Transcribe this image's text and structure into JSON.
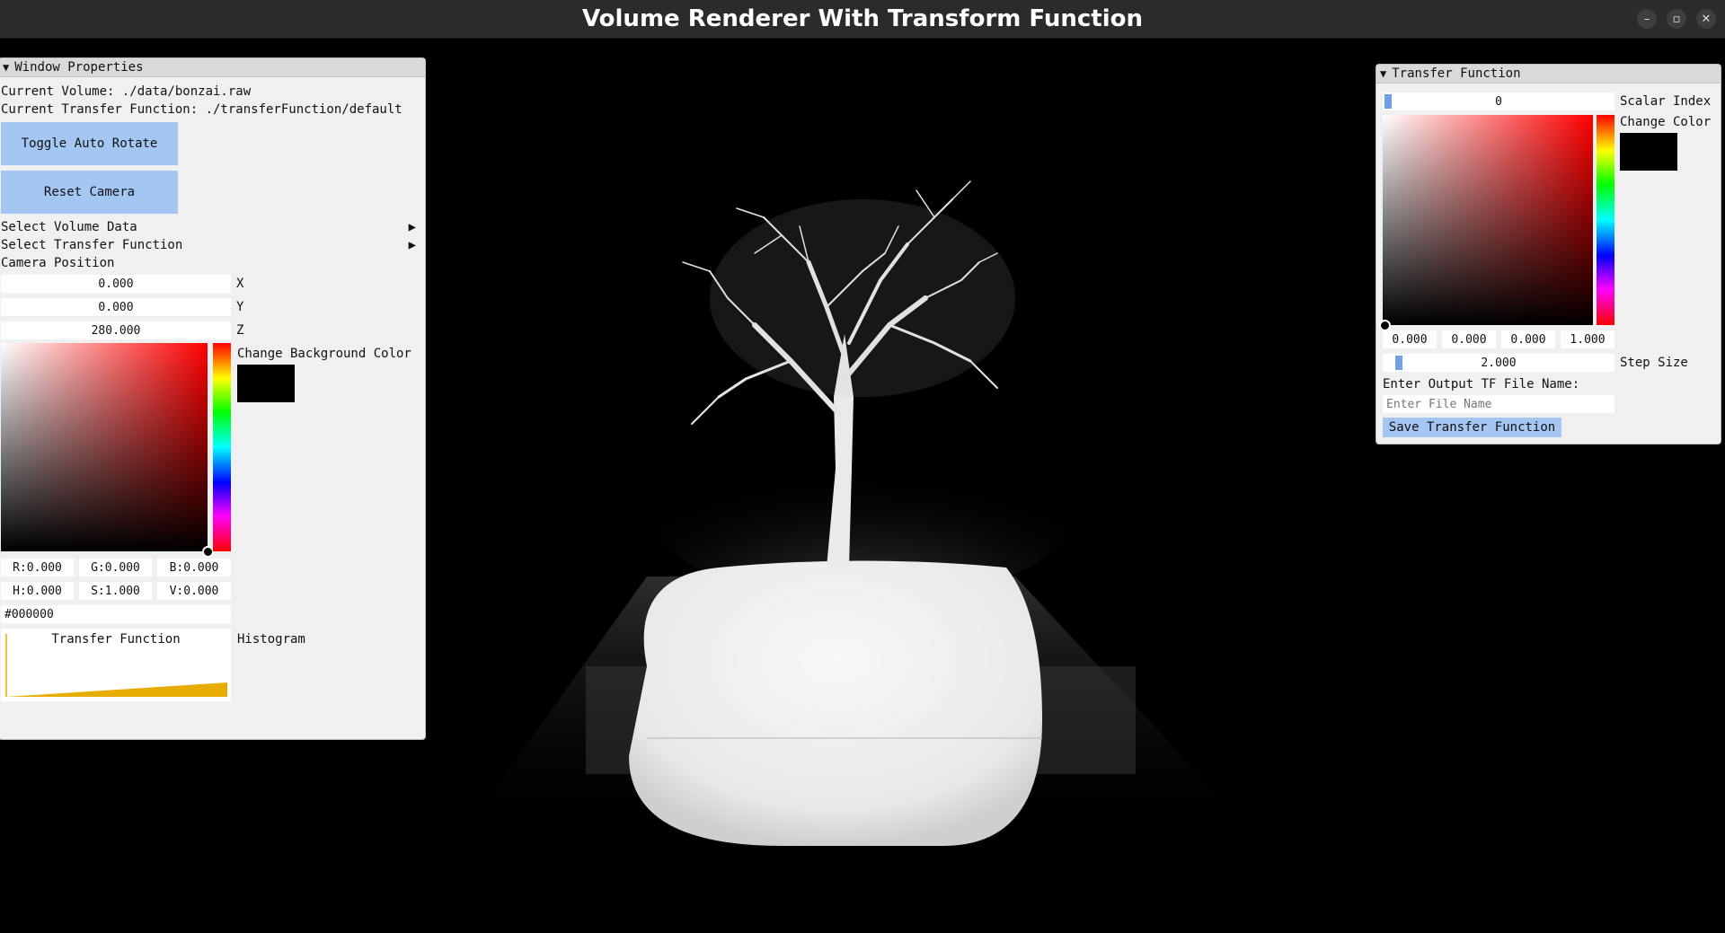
{
  "window": {
    "title": "Volume Renderer With Transform Function"
  },
  "window_controls": {
    "minimize": "–",
    "restore": "▫",
    "close": "✕"
  },
  "window_properties": {
    "header": "Window Properties",
    "current_volume": "Current Volume: ./data/bonzai.raw",
    "current_tf": "Current Transfer Function: ./transferFunction/default",
    "toggle_auto_rotate": "Toggle Auto Rotate",
    "reset_camera": "Reset Camera",
    "select_volume": "Select Volume Data",
    "select_tf": "Select Transfer Function",
    "camera_position_label": "Camera Position",
    "camera": {
      "x": "0.000",
      "y": "0.000",
      "z": "280.000",
      "x_label": "X",
      "y_label": "Y",
      "z_label": "Z"
    },
    "bg_color_label": "Change Background Color",
    "rgb": {
      "r": "R:0.000",
      "g": "G:0.000",
      "b": "B:0.000"
    },
    "hsv": {
      "h": "H:0.000",
      "s": "S:1.000",
      "v": "V:0.000"
    },
    "hex": "#000000",
    "tf_plot_label": "Transfer Function",
    "histogram_label": "Histogram",
    "colors": {
      "tf_fill": "#e6ac00",
      "bg_color": "#000000"
    }
  },
  "transfer_function": {
    "header": "Transfer Function",
    "scalar_index": "0",
    "scalar_index_label": "Scalar Index",
    "change_color_label": "Change Color",
    "rgba": [
      "0.000",
      "0.000",
      "0.000",
      "1.000"
    ],
    "step_size": "2.000",
    "step_size_label": "Step Size",
    "output_label": "Enter Output TF File Name:",
    "file_placeholder": "Enter File Name",
    "save_button": "Save Transfer Function"
  }
}
